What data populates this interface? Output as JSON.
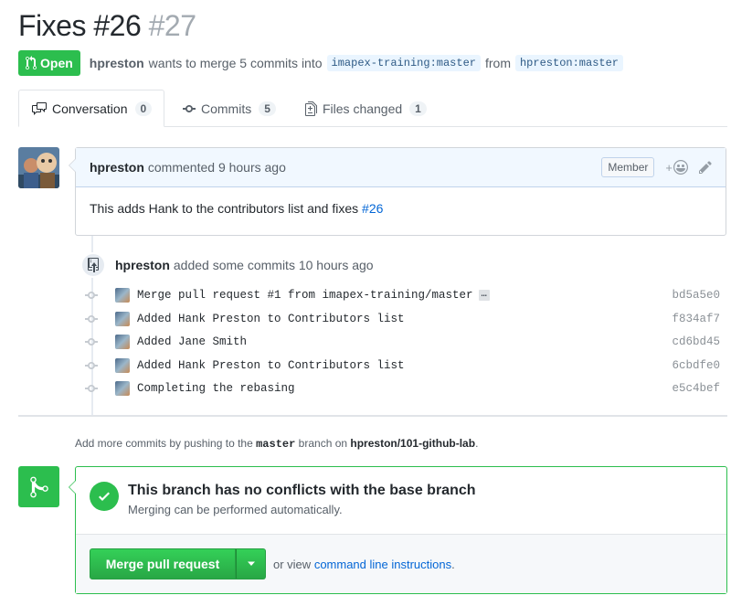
{
  "pr": {
    "title": "Fixes #26",
    "number": "#27",
    "state": "Open",
    "author": "hpreston",
    "meta_text": "wants to merge 5 commits into",
    "base_org": "imapex-training",
    "base_branch": "master",
    "from_text": "from",
    "head_org": "hpreston",
    "head_branch": "master"
  },
  "tabs": [
    {
      "label": "Conversation",
      "count": "0"
    },
    {
      "label": "Commits",
      "count": "5"
    },
    {
      "label": "Files changed",
      "count": "1"
    }
  ],
  "comment": {
    "author": "hpreston",
    "action": "commented",
    "time": "9 hours ago",
    "role": "Member",
    "body": "This adds Hank to the contributors list and fixes",
    "issue_link": "#26"
  },
  "event": {
    "author": "hpreston",
    "action": "added some commits",
    "time": "10 hours ago"
  },
  "commits": [
    {
      "message": "Merge pull request #1 from imapex-training/master",
      "sha": "bd5a5e0",
      "ellipsis": "…"
    },
    {
      "message": "Added Hank Preston to Contributors list",
      "sha": "f834af7"
    },
    {
      "message": "Added Jane Smith",
      "sha": "cd6bd45"
    },
    {
      "message": "Added Hank Preston to Contributors list",
      "sha": "6cbdfe0"
    },
    {
      "message": "Completing the rebasing",
      "sha": "e5c4bef"
    }
  ],
  "more_commits": {
    "prefix": "Add more commits by pushing to the",
    "branch": "master",
    "middle": "branch on",
    "repo": "hpreston/101-github-lab",
    "suffix": "."
  },
  "merge": {
    "title": "This branch has no conflicts with the base branch",
    "subtitle": "Merging can be performed automatically.",
    "button": "Merge pull request",
    "or_text": "or view",
    "cli_link": "command line instructions",
    "period": "."
  },
  "colors": {
    "green": "#2cbe4e",
    "link": "#0366d6",
    "branch_bg": "#eaf5ff"
  },
  "icons": [
    "pr-open-icon",
    "comment-discussion-icon",
    "commit-icon",
    "file-diff-icon",
    "emoji-icon",
    "pencil-icon",
    "repo-push-icon",
    "merge-icon",
    "check-icon",
    "caret-down-icon"
  ]
}
